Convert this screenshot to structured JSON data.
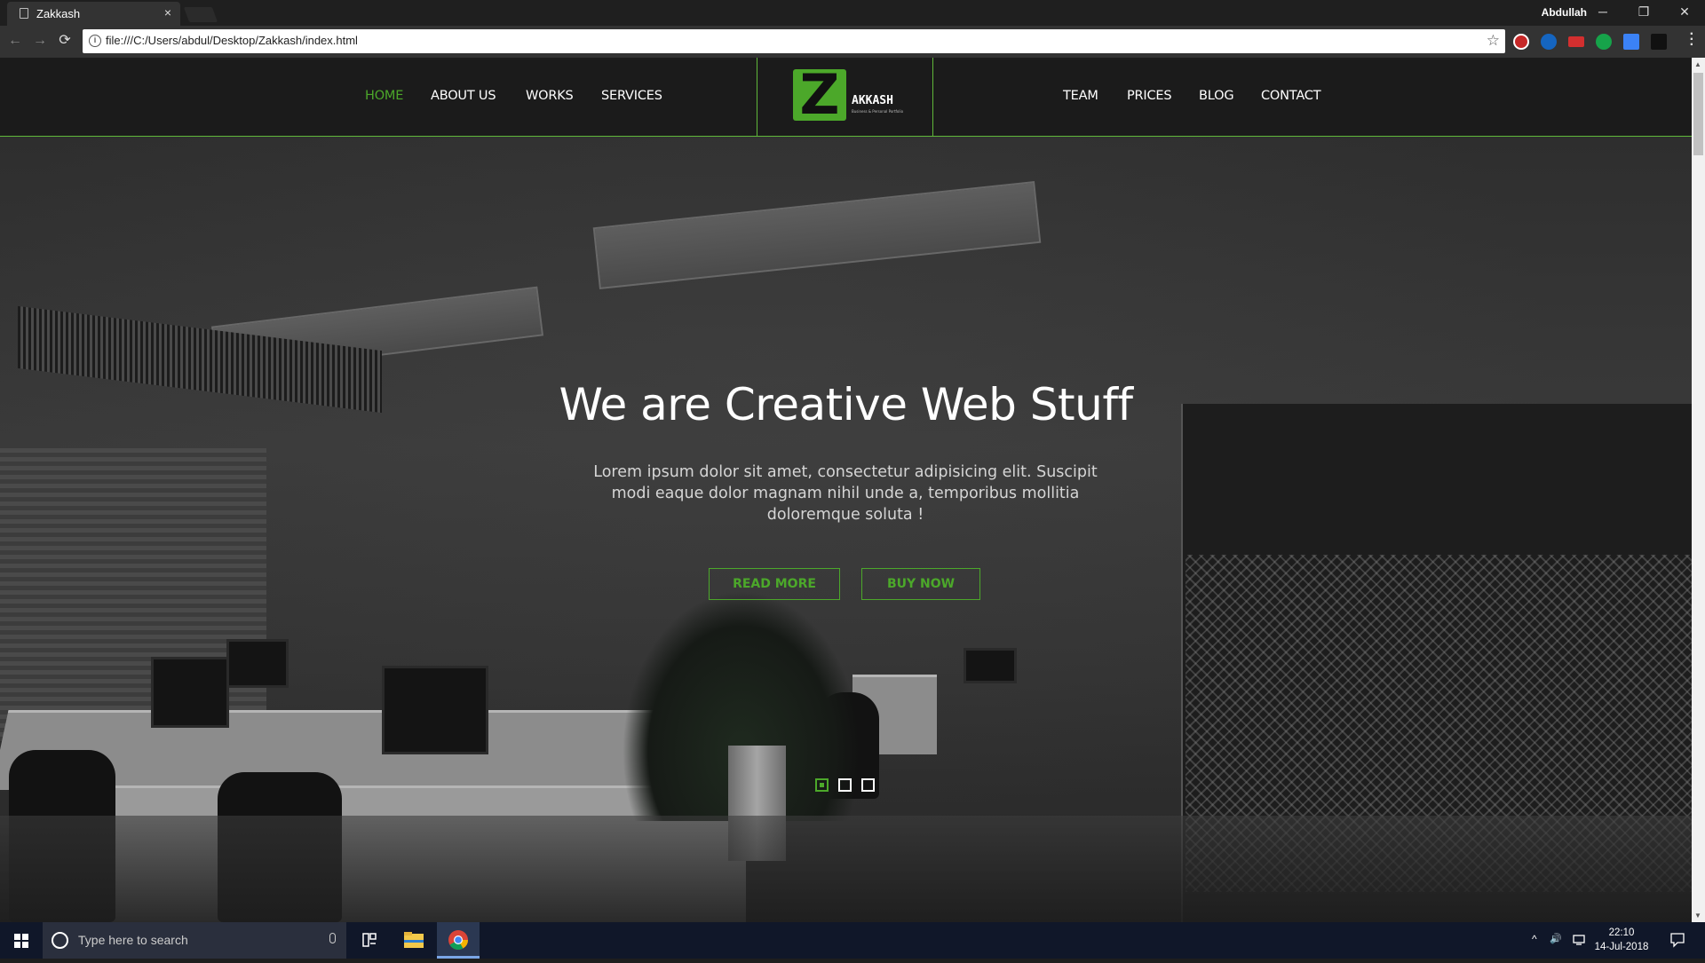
{
  "browser": {
    "tab_title": "Zakkash",
    "tab_close": "×",
    "user_name": "Abdullah",
    "url": "file:///C:/Users/abdul/Desktop/Zakkash/index.html",
    "window_controls": {
      "minimize": "─",
      "restore": "❐",
      "close": "✕"
    },
    "nav": {
      "back": "←",
      "forward": "→",
      "reload": "⟳",
      "star": "☆"
    }
  },
  "site": {
    "nav_left": [
      {
        "label": "HOME",
        "active": true
      },
      {
        "label": "ABOUT US"
      },
      {
        "label": "WORKS"
      },
      {
        "label": "SERVICES"
      }
    ],
    "nav_right": [
      {
        "label": "TEAM"
      },
      {
        "label": "PRICES"
      },
      {
        "label": "BLOG"
      },
      {
        "label": "CONTACT"
      }
    ],
    "logo": {
      "letter": "Z",
      "name": "AKKASH",
      "tagline": "Business & Personal Portfolio"
    }
  },
  "hero": {
    "title": "We are Creative Web Stuff",
    "text": "Lorem ipsum dolor sit amet, consectetur adipisicing elit. Suscipit modi eaque dolor magnam nihil unde a, temporibus mollitia doloremque soluta !",
    "read_more": "READ MORE",
    "buy_now": "BUY NOW",
    "slides": 3,
    "active_slide": 1
  },
  "colors": {
    "accent": "#4ca82a",
    "header_bg": "#1b1b1b",
    "taskbar_bg": "#101729"
  },
  "taskbar": {
    "search_placeholder": "Type here to search",
    "time": "22:10",
    "date": "14-Jul-2018",
    "tray_expand": "^",
    "volume": "🔊"
  }
}
